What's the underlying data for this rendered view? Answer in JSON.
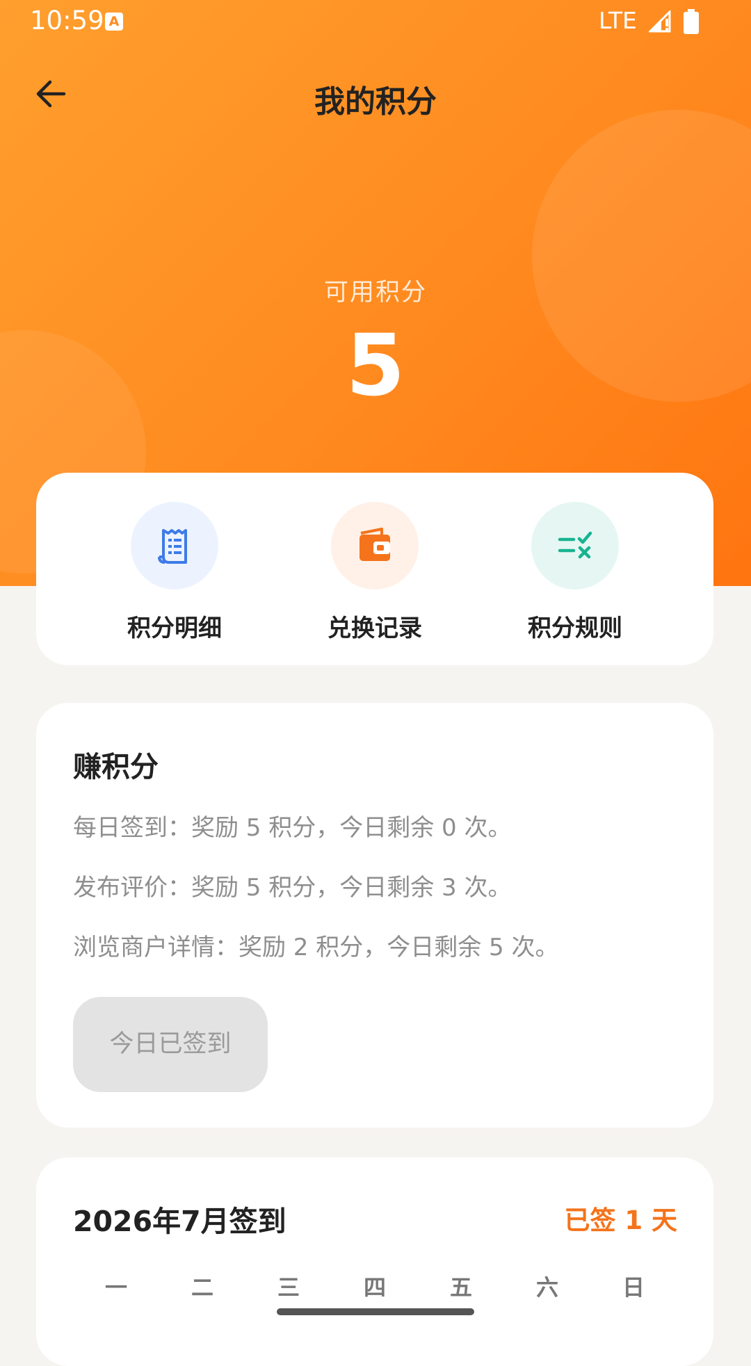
{
  "status_bar": {
    "time": "10:59",
    "notification_icon": "A",
    "network": "LTE"
  },
  "header": {
    "title": "我的积分",
    "back_icon": "arrow-left-icon"
  },
  "points": {
    "label": "可用积分",
    "value": "5"
  },
  "actions": [
    {
      "label": "积分明细",
      "icon": "receipt-icon",
      "bg": "#edf3fe",
      "color": "#3d7be8"
    },
    {
      "label": "兑换记录",
      "icon": "wallet-icon",
      "bg": "#fff1e7",
      "color": "#f4731b"
    },
    {
      "label": "积分规则",
      "icon": "rules-icon",
      "bg": "#e6f7f3",
      "color": "#19b391"
    }
  ],
  "earn": {
    "title": "赚积分",
    "lines": [
      "每日签到：奖励 5 积分，今日剩余 0 次。",
      "发布评价：奖励 5 积分，今日剩余 3 次。",
      "浏览商户详情：奖励 2 积分，今日剩余 5 次。"
    ],
    "button_label": "今日已签到"
  },
  "calendar": {
    "title": "2026年7月签到",
    "signed_days": "已签 1 天",
    "weekdays": [
      "一",
      "二",
      "三",
      "四",
      "五",
      "六",
      "日"
    ]
  },
  "colors": {
    "accent": "#ff8a1f",
    "accent_text": "#f4731b"
  }
}
